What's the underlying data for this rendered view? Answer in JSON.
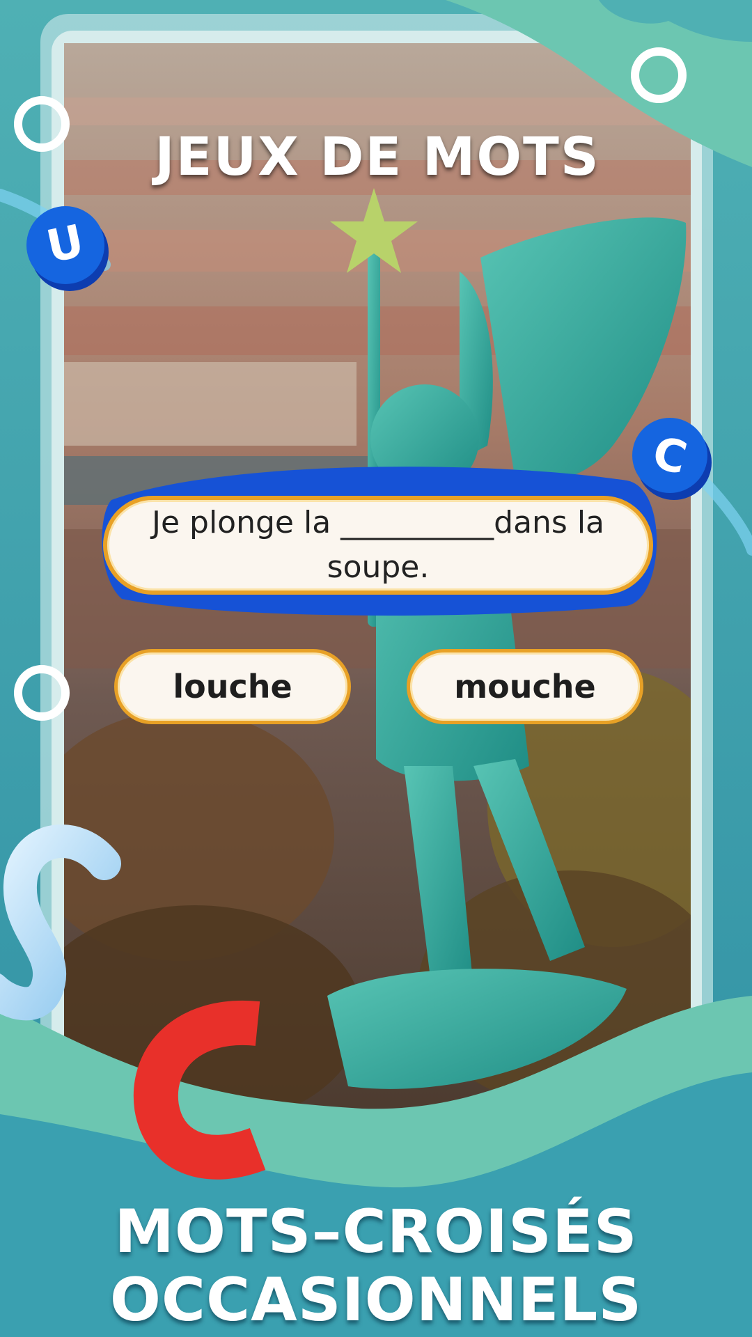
{
  "game": {
    "header_title": "JEUX DE MOTS",
    "question": "Je plonge la __________dans la soupe.",
    "answers": [
      "louche",
      "mouche"
    ]
  },
  "footer": {
    "line1": "MOTS–CROISÉS",
    "line2": "OCCASIONNELS"
  },
  "decor": {
    "letter_badges": [
      "U",
      "C"
    ],
    "colors": {
      "teal_bg": "#3a9fb0",
      "mint_wave": "#6cc4b0",
      "button_border": "#e8a126",
      "button_fill": "#fbf6ef",
      "badge_blue": "#1565e0",
      "accent_red": "#e8302a"
    }
  }
}
